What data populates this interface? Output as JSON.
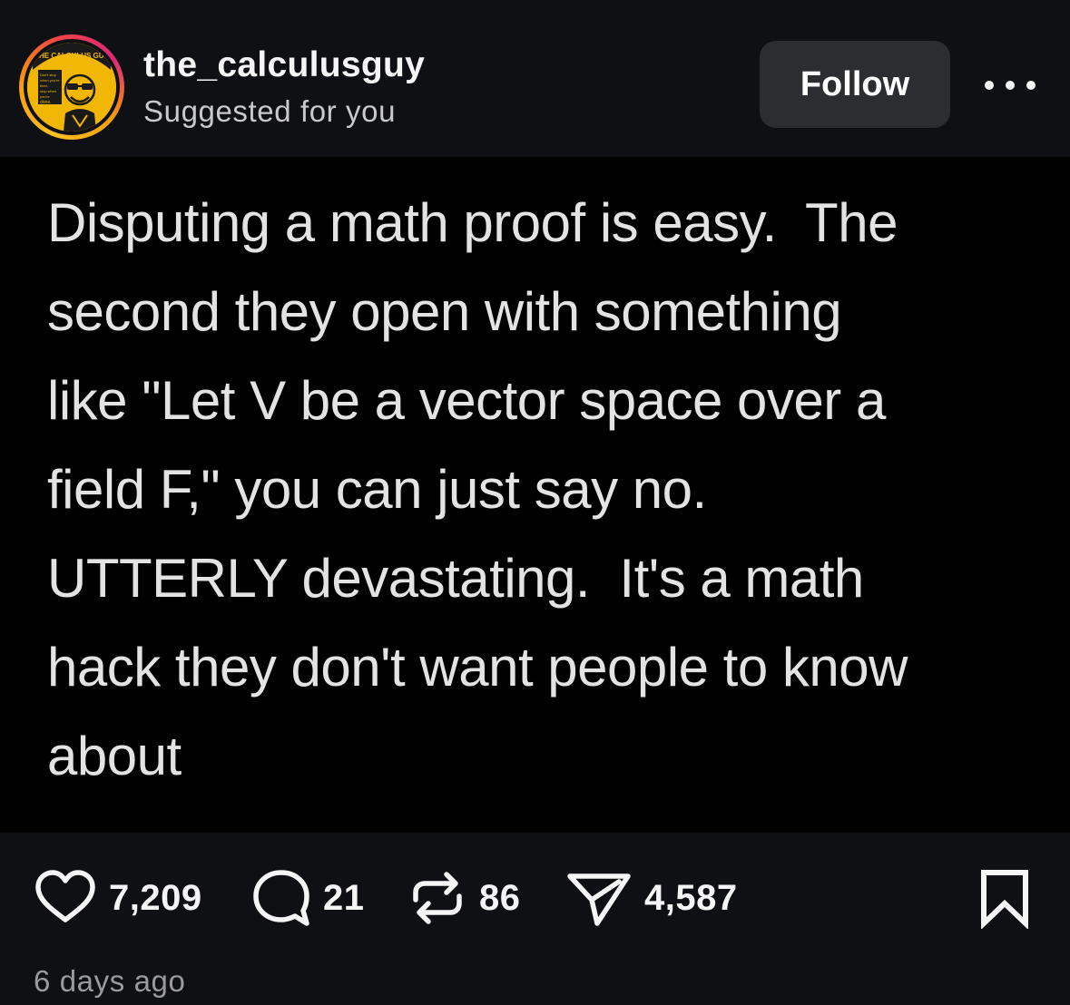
{
  "header": {
    "username": "the_calculusguy",
    "subtitle": "Suggested for you",
    "follow_label": "Follow",
    "avatar": {
      "badge_text": "THE CALCULUS GUY",
      "slogan_lines": [
        "Don't stop",
        "when you're",
        "tired,",
        "stop when",
        "you're",
        "done."
      ]
    }
  },
  "post": {
    "lines": [
      "Disputing a math proof is easy.  The",
      "second they open with something",
      "like \"Let V be a vector space over a",
      "field F,\" you can just say no.",
      "UTTERLY devastating.  It's a math",
      "hack they don't want people to know",
      "about"
    ]
  },
  "actions": {
    "likes": "7,209",
    "comments": "21",
    "reposts": "86",
    "shares": "4,587"
  },
  "timestamp": "6 days ago",
  "icons": {
    "like": "heart-icon",
    "comment": "comment-bubble-icon",
    "repost": "repost-arrows-icon",
    "share": "paper-plane-icon",
    "save": "bookmark-icon",
    "more": "more-dots-icon"
  }
}
